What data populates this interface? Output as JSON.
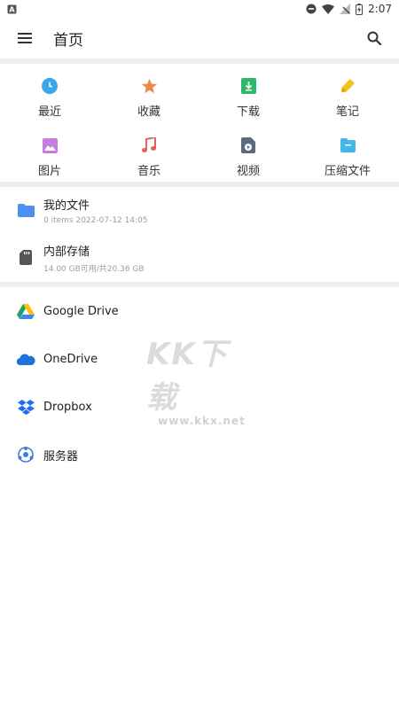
{
  "status_bar": {
    "time": "2:07",
    "left_icon": "notification-a-icon",
    "right_icons": [
      "do-not-disturb-icon",
      "wifi-icon",
      "signal-off-icon",
      "battery-charging-icon"
    ]
  },
  "app_bar": {
    "title": "首页",
    "menu_icon": "menu-icon",
    "search_icon": "search-icon"
  },
  "categories": [
    {
      "label": "最近",
      "icon": "clock-icon",
      "color": "#3aa7e8"
    },
    {
      "label": "收藏",
      "icon": "star-icon",
      "color": "#f0884a"
    },
    {
      "label": "下载",
      "icon": "download-icon",
      "color": "#2fb86a"
    },
    {
      "label": "笔记",
      "icon": "pencil-icon",
      "color": "#f2c21b"
    },
    {
      "label": "图片",
      "icon": "image-icon",
      "color": "#c77ddb"
    },
    {
      "label": "音乐",
      "icon": "music-icon",
      "color": "#e8615b"
    },
    {
      "label": "视频",
      "icon": "video-icon",
      "color": "#5a6b7c"
    },
    {
      "label": "压缩文件",
      "icon": "archive-icon",
      "color": "#3fb8e6"
    }
  ],
  "storage": [
    {
      "title": "我的文件",
      "subtitle": "0 items 2022-07-12 14:05",
      "icon": "folder-icon",
      "color": "#4f8ff0"
    },
    {
      "title": "内部存储",
      "subtitle": "14.00 GB可用/共20.36 GB",
      "icon": "sd-card-icon",
      "color": "#555555"
    }
  ],
  "cloud": [
    {
      "title": "Google Drive",
      "icon": "google-drive-icon"
    },
    {
      "title": "OneDrive",
      "icon": "onedrive-icon",
      "color": "#1e74d6"
    },
    {
      "title": "Dropbox",
      "icon": "dropbox-icon",
      "color": "#1f6ff0"
    },
    {
      "title": "服务器",
      "icon": "server-icon",
      "color": "#3b7de0"
    }
  ],
  "watermark": {
    "big": "KK下载",
    "small": "www.kkx.net"
  }
}
